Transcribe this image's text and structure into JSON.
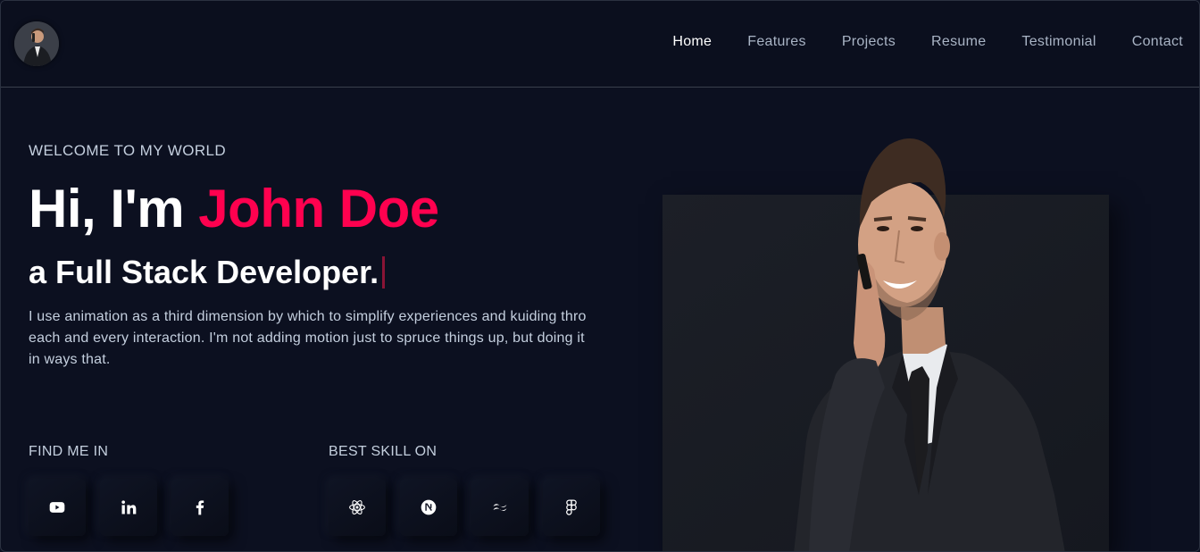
{
  "nav": {
    "items": [
      "Home",
      "Features",
      "Projects",
      "Resume",
      "Testimonial",
      "Contact"
    ],
    "active": "Home"
  },
  "hero": {
    "welcome": "WELCOME TO MY WORLD",
    "greeting": "Hi, I'm ",
    "name": "John Doe",
    "role": "a Full Stack Developer.",
    "description": "I use animation as a third dimension by which to simplify experiences and kuiding thro each and every interaction. I'm not adding motion just to spruce things up, but doing it in ways that."
  },
  "social": {
    "label": "FIND ME IN",
    "icons": [
      "youtube-icon",
      "linkedin-icon",
      "facebook-icon"
    ]
  },
  "skills": {
    "label": "BEST SKILL ON",
    "icons": [
      "react-icon",
      "nextjs-icon",
      "tailwind-icon",
      "figma-icon"
    ]
  },
  "colors": {
    "accent": "#ff014f",
    "background": "#0c1020",
    "text": "#c4cfde"
  }
}
